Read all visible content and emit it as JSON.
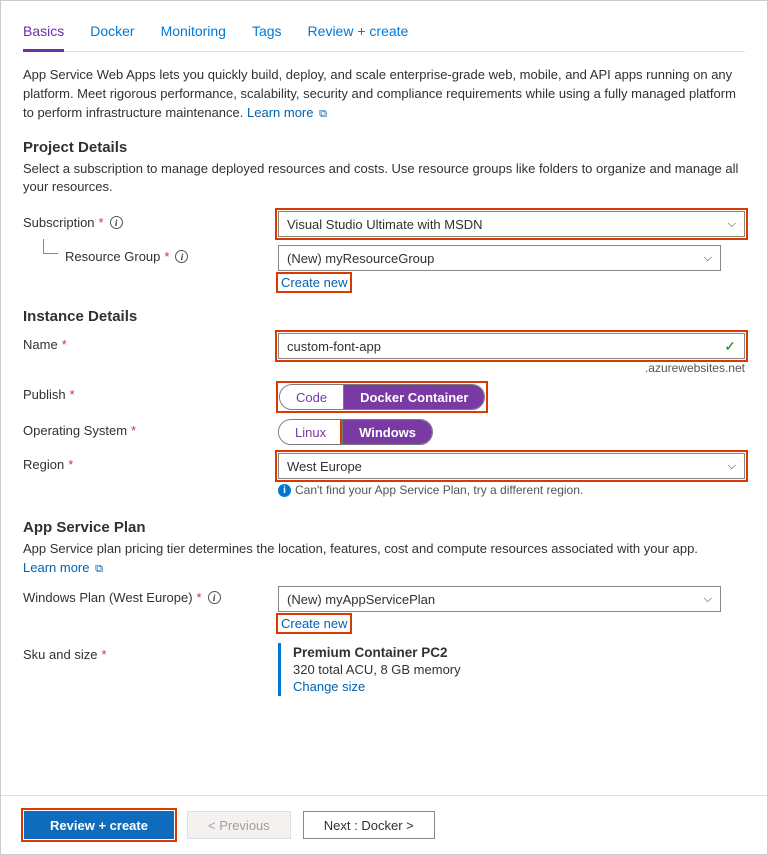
{
  "tabs": {
    "basics": "Basics",
    "docker": "Docker",
    "monitoring": "Monitoring",
    "tags": "Tags",
    "review": "Review + create"
  },
  "intro": "App Service Web Apps lets you quickly build, deploy, and scale enterprise-grade web, mobile, and API apps running on any platform. Meet rigorous performance, scalability, security and compliance requirements while using a fully managed platform to perform infrastructure maintenance.   ",
  "learnMore": "Learn more",
  "sections": {
    "project": {
      "title": "Project Details",
      "desc": "Select a subscription to manage deployed resources and costs. Use resource groups like folders to organize and manage all your resources.",
      "subscription": {
        "label": "Subscription",
        "value": "Visual Studio Ultimate with MSDN"
      },
      "rg": {
        "label": "Resource Group",
        "value": "(New) myResourceGroup",
        "createNew": "Create new"
      }
    },
    "instance": {
      "title": "Instance Details",
      "name": {
        "label": "Name",
        "value": "custom-font-app",
        "suffix": ".azurewebsites.net"
      },
      "publish": {
        "label": "Publish",
        "opt1": "Code",
        "opt2": "Docker Container"
      },
      "os": {
        "label": "Operating System",
        "opt1": "Linux",
        "opt2": "Windows"
      },
      "region": {
        "label": "Region",
        "value": "West Europe",
        "hint": "Can't find your App Service Plan, try a different region."
      }
    },
    "plan": {
      "title": "App Service Plan",
      "desc": "App Service plan pricing tier determines the location, features, cost and compute resources associated with your app.",
      "winPlan": {
        "label": "Windows Plan (West Europe)",
        "value": "(New) myAppServicePlan",
        "createNew": "Create new"
      },
      "sku": {
        "label": "Sku and size",
        "tier": "Premium Container PC2",
        "detail": "320 total ACU, 8 GB memory",
        "change": "Change size"
      }
    }
  },
  "footer": {
    "review": "Review + create",
    "prev": "< Previous",
    "next": "Next : Docker >"
  }
}
